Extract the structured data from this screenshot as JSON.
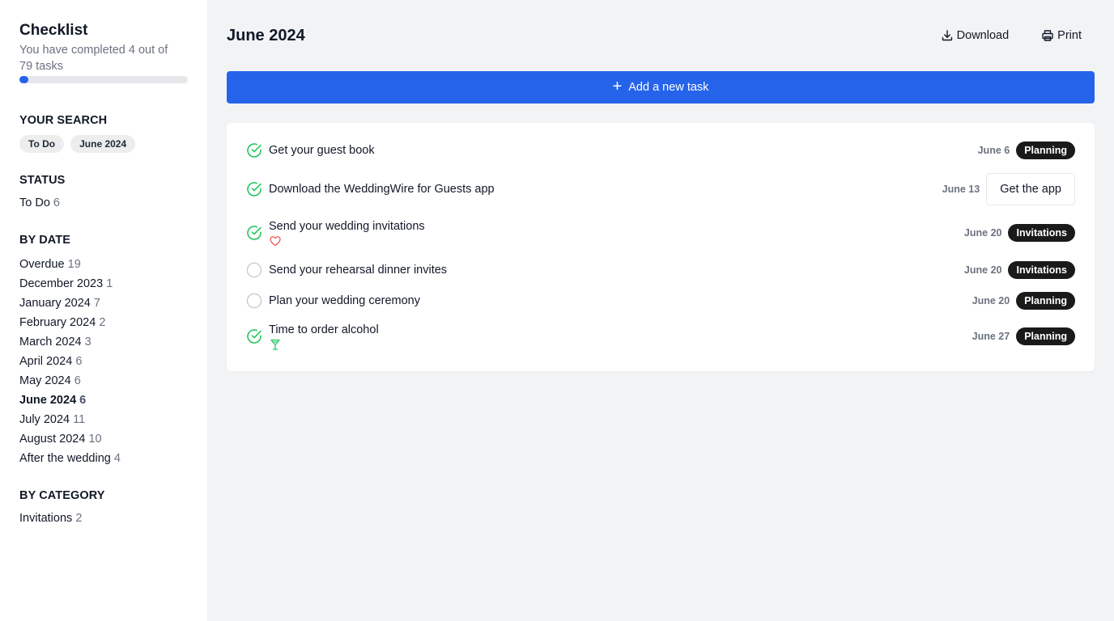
{
  "sidebar": {
    "title": "Checklist",
    "progress_text": "You have completed 4 out of 79 tasks",
    "progress": {
      "completed": 4,
      "total": 79
    },
    "search_heading": "YOUR SEARCH",
    "search_chips": [
      "To Do",
      "June 2024"
    ],
    "status_heading": "STATUS",
    "status_items": [
      {
        "label": "To Do",
        "count": "6"
      }
    ],
    "date_heading": "BY DATE",
    "date_items": [
      {
        "label": "Overdue",
        "count": "19"
      },
      {
        "label": "December 2023",
        "count": "1"
      },
      {
        "label": "January 2024",
        "count": "7"
      },
      {
        "label": "February 2024",
        "count": "2"
      },
      {
        "label": "March 2024",
        "count": "3"
      },
      {
        "label": "April 2024",
        "count": "6"
      },
      {
        "label": "May 2024",
        "count": "6"
      },
      {
        "label": "June 2024",
        "count": "6",
        "active": true
      },
      {
        "label": "July 2024",
        "count": "11"
      },
      {
        "label": "August 2024",
        "count": "10"
      },
      {
        "label": "After the wedding",
        "count": "4"
      }
    ],
    "category_heading": "BY CATEGORY",
    "category_items": [
      {
        "label": "Invitations",
        "count": "2"
      }
    ]
  },
  "main": {
    "title": "June 2024",
    "download_label": "Download",
    "print_label": "Print",
    "add_task_label": "Add a new task",
    "tasks": [
      {
        "title": "Get your guest book",
        "date": "June 6",
        "tag": "Planning",
        "done": true,
        "icon": null
      },
      {
        "title": "Download the WeddingWire for Guests app",
        "date": "June 13",
        "action": "Get the app",
        "done": true,
        "icon": null
      },
      {
        "title": "Send your wedding invitations",
        "date": "June 20",
        "tag": "Invitations",
        "done": true,
        "icon": "heart-icon"
      },
      {
        "title": "Send your rehearsal dinner invites",
        "date": "June 20",
        "tag": "Invitations",
        "done": false,
        "icon": null
      },
      {
        "title": "Plan your wedding ceremony",
        "date": "June 20",
        "tag": "Planning",
        "done": false,
        "icon": null
      },
      {
        "title": "Time to order alcohol",
        "date": "June 27",
        "tag": "Planning",
        "done": true,
        "icon": "cocktail-icon"
      }
    ]
  },
  "colors": {
    "accent": "#2563eb",
    "done_check": "#22c55e",
    "heart": "#ef4444",
    "badge_bg": "#1a1a1a"
  }
}
